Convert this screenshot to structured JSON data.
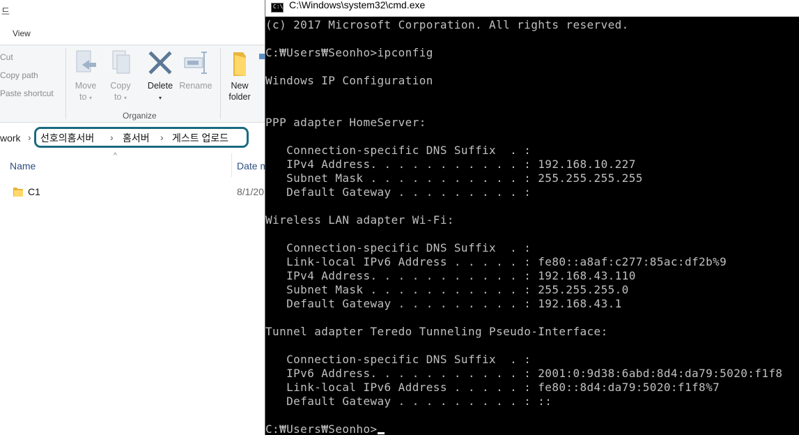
{
  "explorer": {
    "title_fragment": "드",
    "tabs": {
      "view": "View"
    },
    "clipboard": {
      "cut": "Cut",
      "copy_path": "Copy path",
      "paste_shortcut": "Paste shortcut"
    },
    "organize": {
      "move_to": {
        "line1": "Move",
        "line2": "to"
      },
      "copy_to": {
        "line1": "Copy",
        "line2": "to"
      },
      "delete": "Delete",
      "rename": "Rename",
      "group_label": "Organize"
    },
    "new_folder": {
      "line1": "New",
      "line2": "folder"
    },
    "address": {
      "prefix": "work",
      "crumbs": [
        "선호의홈서버",
        "홈서버",
        "게스트 업로드"
      ]
    },
    "columns": {
      "name": "Name",
      "date": "Date m"
    },
    "files": [
      {
        "name": "C1",
        "date": "8/1/20"
      }
    ]
  },
  "cmd": {
    "title": "C:\\Windows\\system32\\cmd.exe",
    "icon_text": "C:\\",
    "lines": [
      "(c) 2017 Microsoft Corporation. All rights reserved.",
      "",
      "C:₩Users₩Seonho>ipconfig",
      "",
      "Windows IP Configuration",
      "",
      "",
      "PPP adapter HomeServer:",
      "",
      "   Connection-specific DNS Suffix  . :",
      "   IPv4 Address. . . . . . . . . . . : 192.168.10.227",
      "   Subnet Mask . . . . . . . . . . . : 255.255.255.255",
      "   Default Gateway . . . . . . . . . :",
      "",
      "Wireless LAN adapter Wi-Fi:",
      "",
      "   Connection-specific DNS Suffix  . :",
      "   Link-local IPv6 Address . . . . . : fe80::a8af:c277:85ac:df2b%9",
      "   IPv4 Address. . . . . . . . . . . : 192.168.43.110",
      "   Subnet Mask . . . . . . . . . . . : 255.255.255.0",
      "   Default Gateway . . . . . . . . . : 192.168.43.1",
      "",
      "Tunnel adapter Teredo Tunneling Pseudo-Interface:",
      "",
      "   Connection-specific DNS Suffix  . :",
      "   IPv6 Address. . . . . . . . . . . : 2001:0:9d38:6abd:8d4:da79:5020:f1f8",
      "   Link-local IPv6 Address . . . . . : fe80::8d4:da79:5020:f1f8%7",
      "   Default Gateway . . . . . . . . . : ::",
      "",
      "C:₩Users₩Seonho>"
    ]
  }
}
